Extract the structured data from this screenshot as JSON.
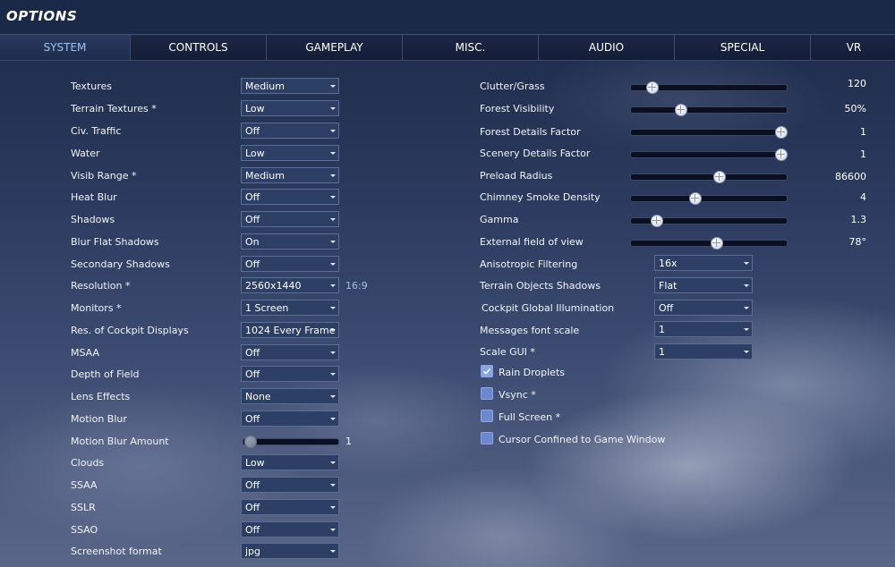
{
  "window": {
    "title": "OPTIONS"
  },
  "tabs": [
    {
      "label": "SYSTEM",
      "active": true
    },
    {
      "label": "CONTROLS"
    },
    {
      "label": "GAMEPLAY"
    },
    {
      "label": "MISC."
    },
    {
      "label": "AUDIO"
    },
    {
      "label": "SPECIAL"
    },
    {
      "label": "VR"
    }
  ],
  "left": {
    "textures": {
      "label": "Textures",
      "value": "Medium"
    },
    "terrain_textures": {
      "label": "Terrain Textures *",
      "value": "Low"
    },
    "civ_traffic": {
      "label": "Civ. Traffic",
      "value": "Off"
    },
    "water": {
      "label": "Water",
      "value": "Low"
    },
    "visib_range": {
      "label": "Visib Range *",
      "value": "Medium"
    },
    "heat_blur": {
      "label": "Heat Blur",
      "value": "Off"
    },
    "shadows": {
      "label": "Shadows",
      "value": "Off"
    },
    "blur_flat_shadows": {
      "label": "Blur Flat Shadows",
      "value": "On"
    },
    "secondary_shadows": {
      "label": "Secondary Shadows",
      "value": "Off"
    },
    "resolution": {
      "label": "Resolution *",
      "value": "2560x1440",
      "aspect": "16:9"
    },
    "monitors": {
      "label": "Monitors *",
      "value": "1 Screen"
    },
    "res_cockpit": {
      "label": "Res. of Cockpit Displays",
      "value": "1024 Every Frame"
    },
    "msaa": {
      "label": "MSAA",
      "value": "Off"
    },
    "depth_of_field": {
      "label": "Depth of Field",
      "value": "Off"
    },
    "lens_effects": {
      "label": "Lens Effects",
      "value": "None"
    },
    "motion_blur": {
      "label": "Motion Blur",
      "value": "Off"
    },
    "motion_blur_amount": {
      "label": "Motion Blur Amount",
      "value": "1",
      "fraction": 0.0
    },
    "clouds": {
      "label": "Clouds",
      "value": "Low"
    },
    "ssaa": {
      "label": "SSAA",
      "value": "Off"
    },
    "sslr": {
      "label": "SSLR",
      "value": "Off"
    },
    "ssao": {
      "label": "SSAO",
      "value": "Off"
    },
    "screenshot_format": {
      "label": "Screenshot format",
      "value": "jpg"
    }
  },
  "right": {
    "clutter_grass": {
      "label": "Clutter/Grass",
      "value": "120",
      "fraction": 0.1
    },
    "forest_visibility": {
      "label": "Forest Visibility",
      "value": "50%",
      "fraction": 0.3
    },
    "forest_details": {
      "label": "Forest Details Factor",
      "value": "1",
      "fraction": 1.0
    },
    "scenery_details": {
      "label": "Scenery Details Factor",
      "value": "1",
      "fraction": 1.0
    },
    "preload_radius": {
      "label": "Preload Radius",
      "value": "86600",
      "fraction": 0.57
    },
    "chimney_smoke": {
      "label": "Chimney Smoke Density",
      "value": "4",
      "fraction": 0.4
    },
    "gamma": {
      "label": "Gamma",
      "value": "1.3",
      "fraction": 0.13
    },
    "external_fov": {
      "label": "External field of view",
      "value": "78°",
      "fraction": 0.55
    },
    "anisotropic": {
      "label": "Anisotropic Filtering",
      "value": "16x"
    },
    "terrain_objects_shadows": {
      "label": "Terrain Objects Shadows",
      "value": "Flat"
    },
    "cockpit_gi": {
      "label": "Cockpit Global Illumination",
      "value": "Off"
    },
    "messages_font_scale": {
      "label": "Messages font scale",
      "value": "1"
    },
    "scale_gui": {
      "label": "Scale GUI *",
      "value": "1"
    },
    "rain_droplets": {
      "label": "Rain Droplets",
      "checked": true
    },
    "vsync": {
      "label": "Vsync *",
      "checked": false
    },
    "full_screen": {
      "label": "Full Screen *",
      "checked": false
    },
    "cursor_confined": {
      "label": "Cursor Confined to Game Window",
      "checked": false
    }
  },
  "colors": {
    "accent": "#9fc3ef",
    "header_bg": "#1b2949",
    "checkbox": "#6c88cf"
  },
  "icons": {
    "dropdown": "chevron-down-icon",
    "checkbox_checked": "check-icon"
  }
}
